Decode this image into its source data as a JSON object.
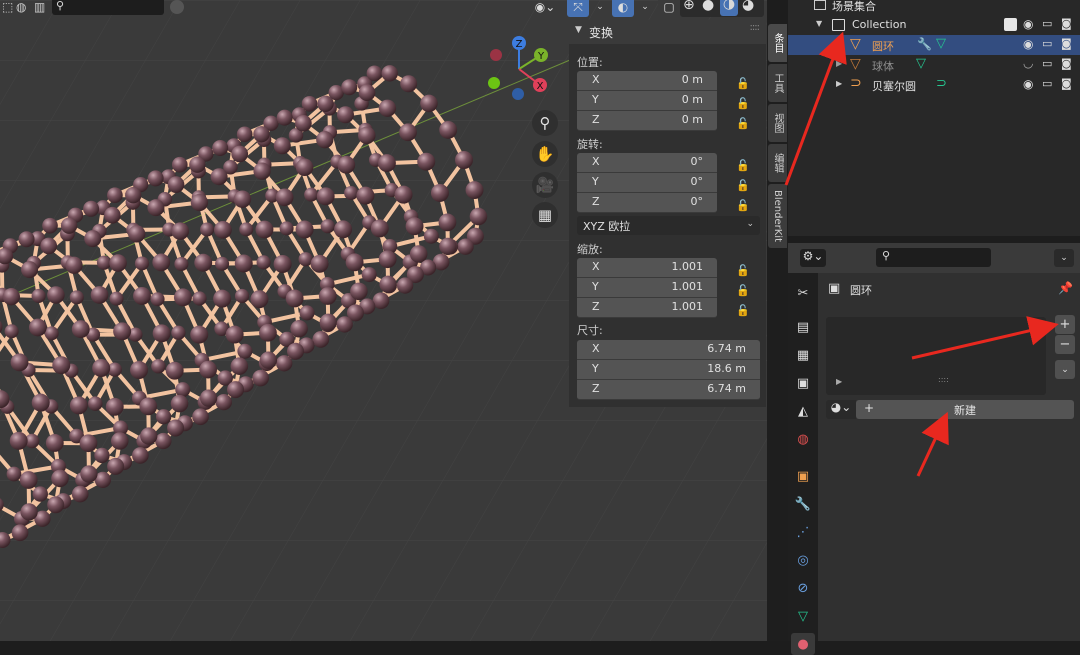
{
  "viewport": {
    "nav_icons": [
      "zoom-icon",
      "hand-pan-icon",
      "camera-icon",
      "grid-icon"
    ],
    "gizmo": {
      "x_label": "X",
      "y_label": "Y",
      "z_label": "Z"
    }
  },
  "npanel": {
    "title": "变换",
    "location": {
      "label": "位置:",
      "rows": [
        {
          "axis": "X",
          "value": "0 m"
        },
        {
          "axis": "Y",
          "value": "0 m"
        },
        {
          "axis": "Z",
          "value": "0 m"
        }
      ]
    },
    "rotation": {
      "label": "旋转:",
      "rows": [
        {
          "axis": "X",
          "value": "0°"
        },
        {
          "axis": "Y",
          "value": "0°"
        },
        {
          "axis": "Z",
          "value": "0°"
        }
      ]
    },
    "rotation_mode": "XYZ 欧拉",
    "scale": {
      "label": "缩放:",
      "rows": [
        {
          "axis": "X",
          "value": "1.001"
        },
        {
          "axis": "Y",
          "value": "1.001"
        },
        {
          "axis": "Z",
          "value": "1.001"
        }
      ]
    },
    "dimensions": {
      "label": "尺寸:",
      "rows": [
        {
          "axis": "X",
          "value": "6.74 m"
        },
        {
          "axis": "Y",
          "value": "18.6 m"
        },
        {
          "axis": "Z",
          "value": "6.74 m"
        }
      ]
    }
  },
  "side_tabs": [
    "条目",
    "工具",
    "视图",
    "编辑",
    "BlenderKit"
  ],
  "outliner": {
    "scene_collection": "场景集合",
    "collection": "Collection",
    "objects": [
      {
        "name": "圆环",
        "selected": true
      },
      {
        "name": "球体",
        "selected": false
      },
      {
        "name": "贝塞尔圆",
        "selected": false
      }
    ]
  },
  "properties": {
    "object_name": "圆环",
    "new_button": "新建",
    "add_label": "+",
    "remove_label": "−",
    "plus_label": "+"
  },
  "colors": {
    "accent": "#4772b3",
    "selection": "#334d80",
    "arrow": "#e8281f",
    "atom": "#7a5560",
    "bond": "#f2c3a0"
  }
}
